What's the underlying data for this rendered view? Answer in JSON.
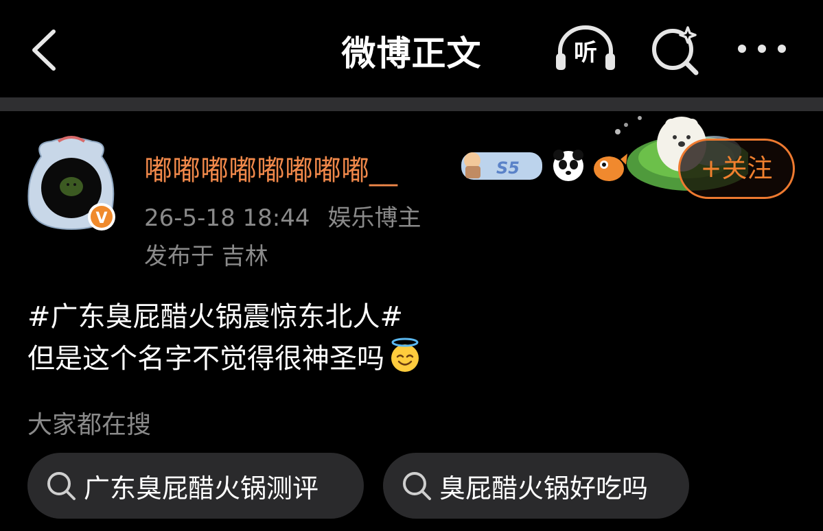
{
  "header": {
    "title": "微博正文",
    "listen_label": "听"
  },
  "post": {
    "username": "嘟嘟嘟嘟嘟嘟嘟嘟__",
    "badge_text": "S5",
    "follow_label": "+关注",
    "timestamp": "26-5-18 18:44",
    "author_tag": "娱乐博主",
    "location": "发布于 吉林",
    "content_lines": [
      "#广东臭屁醋火锅震惊东北人#",
      "但是这个名字不觉得很神圣吗"
    ],
    "content_emoji": "smiling-face-with-halo",
    "verified_mark": "V"
  },
  "search": {
    "label": "大家都在搜",
    "chips": [
      "广东臭屁醋火锅测评",
      "臭屁醋火锅好吃吗"
    ]
  },
  "icons": {
    "back": "chevron-left-icon",
    "listen": "headphones-icon",
    "search": "search-sparkle-icon",
    "more": "more-dots-icon"
  },
  "colors": {
    "background": "#000000",
    "username": "#f0884a",
    "accent": "#ee7a30",
    "muted_text": "#8a8a8a",
    "chip_bg": "#2a2a2c",
    "divider": "#2f2f31"
  }
}
